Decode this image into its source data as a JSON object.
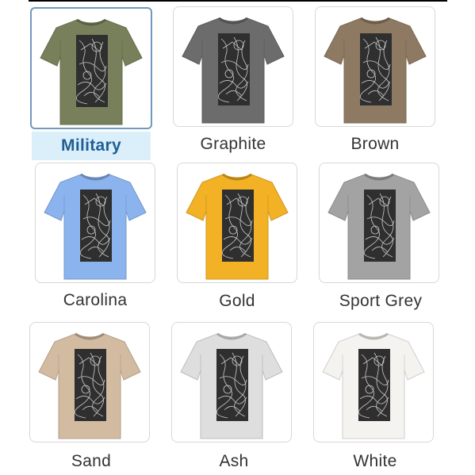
{
  "swatches": [
    {
      "name": "Military",
      "color": "#77805a",
      "selected": true
    },
    {
      "name": "Graphite",
      "color": "#6c6c6c",
      "selected": false
    },
    {
      "name": "Brown",
      "color": "#8e7a62",
      "selected": false
    },
    {
      "name": "Carolina",
      "color": "#8bb3ee",
      "selected": false
    },
    {
      "name": "Gold",
      "color": "#f3b125",
      "selected": false
    },
    {
      "name": "Sport Grey",
      "color": "#a3a3a3",
      "selected": false
    },
    {
      "name": "Sand",
      "color": "#d2bba1",
      "selected": false
    },
    {
      "name": "Ash",
      "color": "#dedede",
      "selected": false
    },
    {
      "name": "White",
      "color": "#f4f3ef",
      "selected": false
    }
  ],
  "print": {
    "ink": "#2f2f2f",
    "linework": "#c9c9c9"
  }
}
